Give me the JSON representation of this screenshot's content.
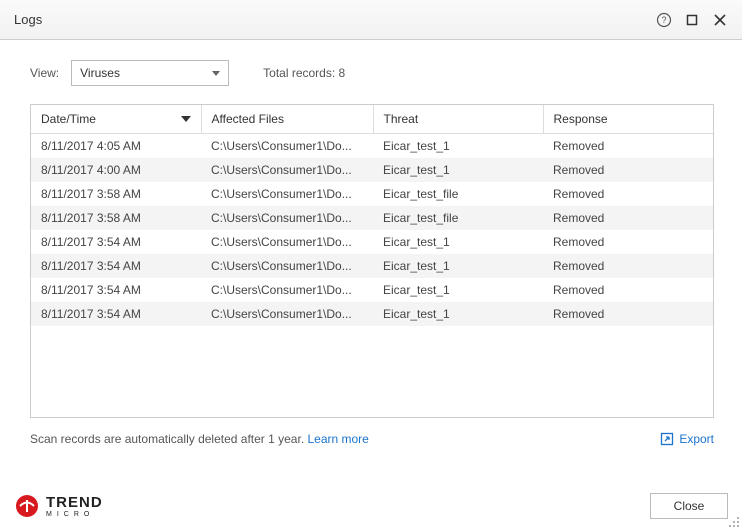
{
  "window": {
    "title": "Logs"
  },
  "toolbar": {
    "view_label": "View:",
    "dropdown_value": "Viruses",
    "total_records_label": "Total records:",
    "total_records_value": "8"
  },
  "columns": {
    "datetime": "Date/Time",
    "affected": "Affected Files",
    "threat": "Threat",
    "response": "Response"
  },
  "rows": [
    {
      "datetime": "8/11/2017 4:05 AM",
      "affected": "C:\\Users\\Consumer1\\Do...",
      "threat": "Eicar_test_1",
      "response": "Removed"
    },
    {
      "datetime": "8/11/2017 4:00 AM",
      "affected": "C:\\Users\\Consumer1\\Do...",
      "threat": "Eicar_test_1",
      "response": "Removed"
    },
    {
      "datetime": "8/11/2017 3:58 AM",
      "affected": "C:\\Users\\Consumer1\\Do...",
      "threat": "Eicar_test_file",
      "response": "Removed"
    },
    {
      "datetime": "8/11/2017 3:58 AM",
      "affected": "C:\\Users\\Consumer1\\Do...",
      "threat": "Eicar_test_file",
      "response": "Removed"
    },
    {
      "datetime": "8/11/2017 3:54 AM",
      "affected": "C:\\Users\\Consumer1\\Do...",
      "threat": "Eicar_test_1",
      "response": "Removed"
    },
    {
      "datetime": "8/11/2017 3:54 AM",
      "affected": "C:\\Users\\Consumer1\\Do...",
      "threat": "Eicar_test_1",
      "response": "Removed"
    },
    {
      "datetime": "8/11/2017 3:54 AM",
      "affected": "C:\\Users\\Consumer1\\Do...",
      "threat": "Eicar_test_1",
      "response": "Removed"
    },
    {
      "datetime": "8/11/2017 3:54 AM",
      "affected": "C:\\Users\\Consumer1\\Do...",
      "threat": "Eicar_test_1",
      "response": "Removed"
    }
  ],
  "footer": {
    "note": "Scan records are automatically deleted after 1 year. ",
    "learn_more": "Learn more",
    "export": "Export"
  },
  "bottom": {
    "brand_big": "TREND",
    "brand_small": "MICRO",
    "close": "Close"
  }
}
